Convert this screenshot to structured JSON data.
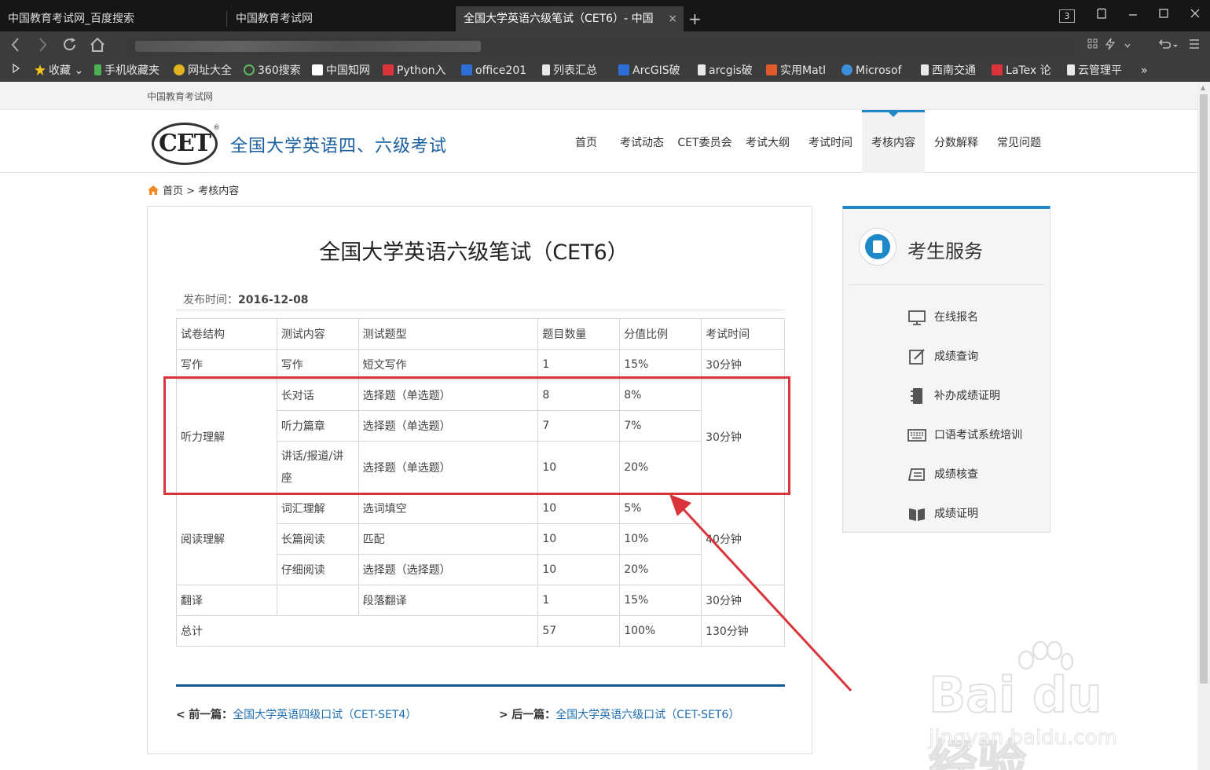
{
  "browser": {
    "tabs": [
      {
        "title": "中国教育考试网_百度搜索",
        "active": false
      },
      {
        "title": "中国教育考试网",
        "active": false
      },
      {
        "title": "全国大学英语六级笔试（CET6）- 中国",
        "active": true
      }
    ],
    "tab_close": "×",
    "new_tab": "+",
    "tab_count": "3",
    "bookmarks": [
      {
        "label": "收藏",
        "icon": "star-icon",
        "color": "#f5c518"
      },
      {
        "label": "手机收藏夹",
        "icon": "phone-icon",
        "color": "#4caf50"
      },
      {
        "label": "网址大全",
        "icon": "plus-circle-icon",
        "color": "#e0b31f"
      },
      {
        "label": "360搜索",
        "icon": "360-icon",
        "color": "#5cb85c"
      },
      {
        "label": "中国知网",
        "icon": "cnki-icon",
        "color": "#ffffff"
      },
      {
        "label": "Python入",
        "icon": "csdn-icon",
        "color": "#d9343a"
      },
      {
        "label": "office201",
        "icon": "baidu-icon",
        "color": "#2d6fd6"
      },
      {
        "label": "列表汇总",
        "icon": "doc-icon",
        "color": "#e8e8e8"
      },
      {
        "label": "ArcGIS破",
        "icon": "baidu-icon",
        "color": "#2d6fd6"
      },
      {
        "label": "arcgis破",
        "icon": "doc-icon",
        "color": "#e8e8e8"
      },
      {
        "label": "实用Matl",
        "icon": "jian-icon",
        "color": "#e05a2b"
      },
      {
        "label": "Microsof",
        "icon": "edge-icon",
        "color": "#3b8fd9"
      },
      {
        "label": "西南交通",
        "icon": "doc-icon",
        "color": "#e8e8e8"
      },
      {
        "label": "LaTex 论",
        "icon": "csdn-icon",
        "color": "#d9343a"
      },
      {
        "label": "云管理平",
        "icon": "doc-icon",
        "color": "#e8e8e8"
      }
    ],
    "bookmarks_more": "»"
  },
  "site": {
    "top_link": "中国教育考试网",
    "logo_text": "CET",
    "logo_reg": "®",
    "title": "全国大学英语四、六级考试",
    "nav": [
      "首页",
      "考试动态",
      "CET委员会",
      "考试大纲",
      "考试时间",
      "考核内容",
      "分数解释",
      "常见问题"
    ],
    "nav_active_index": 5,
    "accent_color": "#1e88c8"
  },
  "breadcrumb": {
    "home": "首页",
    "separator": ">",
    "current": "考核内容"
  },
  "article": {
    "title": "全国大学英语六级笔试（CET6）",
    "date_label": "发布时间：",
    "date": "2016-12-08",
    "table": {
      "headers": [
        "试卷结构",
        "测试内容",
        "测试题型",
        "题目数量",
        "分值比例",
        "考试时间"
      ],
      "writing": {
        "section": "写作",
        "content": "写作",
        "type": "短文写作",
        "count": "1",
        "ratio": "15%",
        "time": "30分钟"
      },
      "listening": {
        "section": "听力理解",
        "time": "30分钟",
        "rows": [
          {
            "content": "长对话",
            "type": "选择题（单选题）",
            "count": "8",
            "ratio": "8%"
          },
          {
            "content": "听力篇章",
            "type": "选择题（单选题）",
            "count": "7",
            "ratio": "7%"
          },
          {
            "content": "讲话/报道/讲座",
            "type": "选择题（单选题）",
            "count": "10",
            "ratio": "20%"
          }
        ]
      },
      "reading": {
        "section": "阅读理解",
        "time": "40分钟",
        "rows": [
          {
            "content": "词汇理解",
            "type": "选词填空",
            "count": "10",
            "ratio": "5%"
          },
          {
            "content": "长篇阅读",
            "type": "匹配",
            "count": "10",
            "ratio": "10%"
          },
          {
            "content": "仔细阅读",
            "type": "选择题（选择题）",
            "count": "10",
            "ratio": "20%"
          }
        ]
      },
      "translation": {
        "section": "翻译",
        "content": "",
        "type": "段落翻译",
        "count": "1",
        "ratio": "15%",
        "time": "30分钟"
      },
      "total": {
        "label": "总计",
        "count": "57",
        "ratio": "100%",
        "time": "130分钟"
      }
    },
    "prev_label": "前一篇：",
    "prev_title": "全国大学英语四级口试（CET-SET4）",
    "next_label": "后一篇：",
    "next_title": "全国大学英语六级口试（CET-SET6）",
    "arrow_glyph": "<",
    "arrow_glyph_next": ">"
  },
  "sidebar": {
    "title": "考生服务",
    "items": [
      {
        "label": "在线报名",
        "icon": "monitor-icon"
      },
      {
        "label": "成绩查询",
        "icon": "edit-icon"
      },
      {
        "label": "补办成绩证明",
        "icon": "notebook-icon"
      },
      {
        "label": "口语考试系统培训",
        "icon": "keyboard-icon"
      },
      {
        "label": "成绩核查",
        "icon": "book-open-icon"
      },
      {
        "label": "成绩证明",
        "icon": "certificate-icon"
      }
    ]
  },
  "annotation": {
    "highlight_color": "#d9343a"
  },
  "watermark": {
    "brand": "Bai du 经验",
    "url": "jingyan.baidu.com"
  }
}
